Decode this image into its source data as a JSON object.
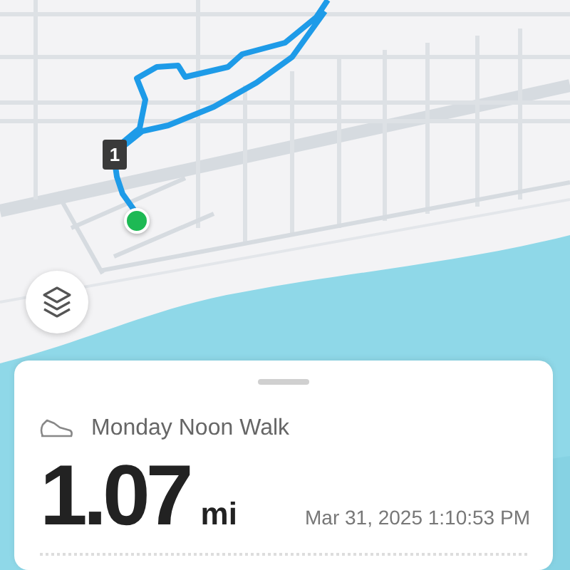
{
  "map": {
    "route_marker": "1"
  },
  "activity": {
    "name": "Monday Noon Walk",
    "distance": "1.07",
    "unit": "mi",
    "date": "Mar 31, 2025 1:10:53 PM"
  }
}
